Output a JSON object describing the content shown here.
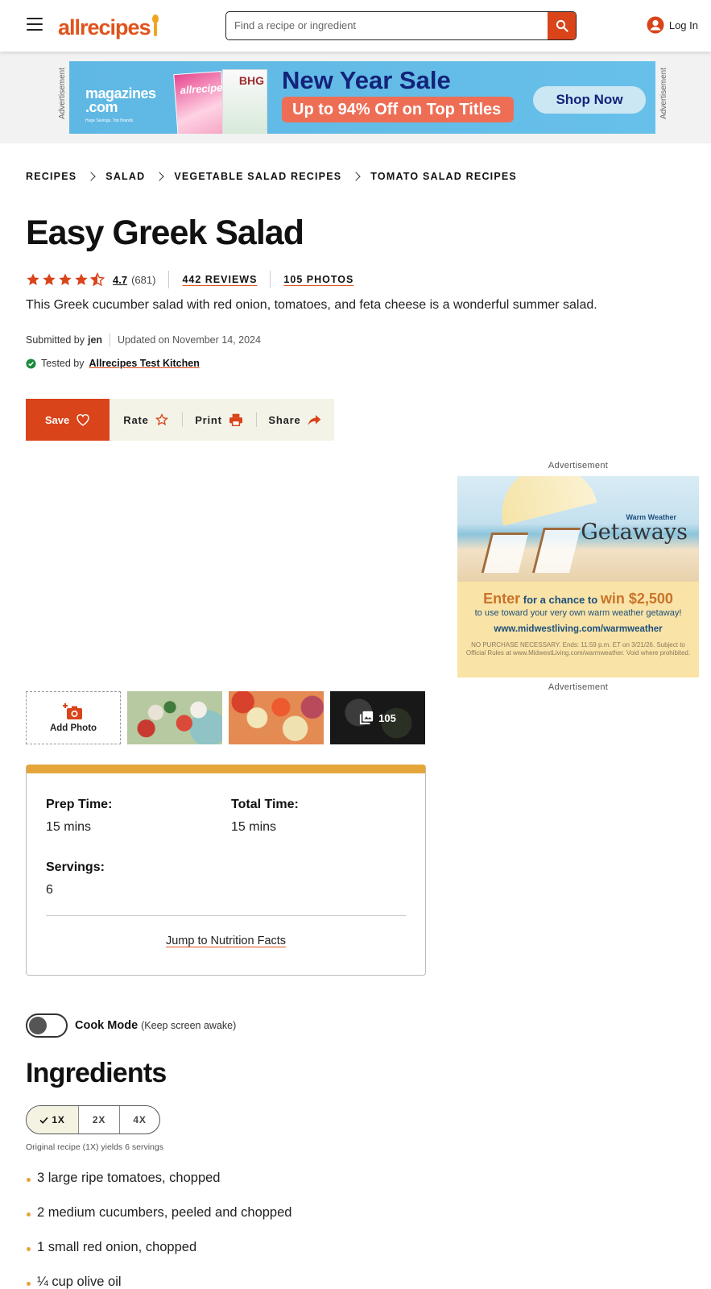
{
  "header": {
    "logo_text": "allrecipes",
    "search_placeholder": "Find a recipe or ingredient",
    "login_label": "Log In"
  },
  "top_ad": {
    "label": "Advertisement",
    "brand": "magazines",
    "brand_tld": ".com",
    "brand_tagline": "Huge Savings. Top Brands.",
    "cover1_title": "allrecipes",
    "cover2_title": "BHG",
    "headline": "New Year Sale",
    "offer": "Up to 94% Off on Top Titles",
    "cta": "Shop Now"
  },
  "breadcrumbs": [
    "RECIPES",
    "SALAD",
    "VEGETABLE SALAD RECIPES",
    "TOMATO SALAD RECIPES"
  ],
  "recipe": {
    "title": "Easy Greek Salad",
    "rating": "4.7",
    "rating_count": "(681)",
    "rating_stars": 4.5,
    "reviews": "442 REVIEWS",
    "photos": "105 PHOTOS",
    "description": "This Greek cucumber salad with red onion, tomatoes, and feta cheese is a wonderful summer salad.",
    "submitted_prefix": "Submitted by",
    "author": "jen",
    "updated": "Updated on November 14, 2024",
    "tested_prefix": "Tested by",
    "tested_by": "Allrecipes Test Kitchen"
  },
  "actions": {
    "save": "Save",
    "rate": "Rate",
    "print": "Print",
    "share": "Share"
  },
  "side_ad": {
    "label_top": "Advertisement",
    "label_bottom": "Advertisement",
    "small_title": "Warm Weather",
    "title": "Getaways",
    "enter": "Enter",
    "for_chance": " for a chance to ",
    "win": "win $2,500",
    "line2": "to use toward your very own warm weather getaway!",
    "url": "www.midwestliving.com/warmweather",
    "fine_print": "NO PURCHASE NECESSARY. Ends: 11:59 p.m. ET on 3/21/26. Subject to Official Rules at www.MidwestLiving.com/warmweather. Void where prohibited."
  },
  "photo_strip": {
    "add_label": "Add Photo",
    "more_count": "105"
  },
  "details": {
    "prep_label": "Prep Time:",
    "prep_value": "15 mins",
    "total_label": "Total Time:",
    "total_value": "15 mins",
    "servings_label": "Servings:",
    "servings_value": "6",
    "jump_label": "Jump to Nutrition Facts"
  },
  "cook_mode": {
    "label": "Cook Mode",
    "sub": "(Keep screen awake)"
  },
  "ingredients": {
    "heading": "Ingredients",
    "scale_options": [
      "1X",
      "2X",
      "4X"
    ],
    "selected_scale": "1X",
    "yields": "Original recipe (1X) yields 6 servings",
    "items": [
      "3 large ripe tomatoes, chopped",
      "2 medium cucumbers, peeled and chopped",
      "1 small red onion, chopped",
      "¼ cup olive oil"
    ]
  },
  "colors": {
    "brand_orange": "#d9441a",
    "accent_gold": "#e4a53b",
    "action_bar_bg": "#f4f3e8"
  }
}
